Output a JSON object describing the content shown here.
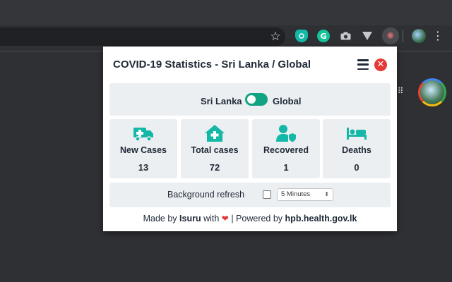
{
  "browser": {
    "star_glyph": "☆",
    "kebab_glyph": "⋮",
    "apps_glyph": "⠿",
    "extensions": [
      {
        "name": "shield-extension-icon"
      },
      {
        "name": "grammarly-icon",
        "glyph": "G"
      },
      {
        "name": "camera-icon",
        "glyph": "📷"
      },
      {
        "name": "vee-icon",
        "glyph": "▼"
      },
      {
        "name": "virus-extension-icon",
        "glyph": "✺"
      }
    ]
  },
  "popup": {
    "title": "COVID-19 Statistics - Sri Lanka / Global",
    "toggle": {
      "left_label": "Sri Lanka",
      "right_label": "Global",
      "on": true
    },
    "stats": [
      {
        "icon": "ambulance-icon",
        "label": "New Cases",
        "value": "13"
      },
      {
        "icon": "hospital-icon",
        "label": "Total cases",
        "value": "72"
      },
      {
        "icon": "user-shield-icon",
        "label": "Recovered",
        "value": "1"
      },
      {
        "icon": "bed-icon",
        "label": "Deaths",
        "value": "0"
      }
    ],
    "refresh": {
      "label": "Background refresh",
      "checked": false,
      "interval": "5 Minutes"
    },
    "footer": {
      "made_by": "Made by",
      "author": "Isuru",
      "with": "with",
      "powered_by": "| Powered by",
      "source": "hpb.health.gov.lk"
    }
  },
  "colors": {
    "accent": "#12a383",
    "icon": "#14b8a6",
    "panel": "#eceff1",
    "close": "#e53935",
    "text": "#1f2937"
  }
}
